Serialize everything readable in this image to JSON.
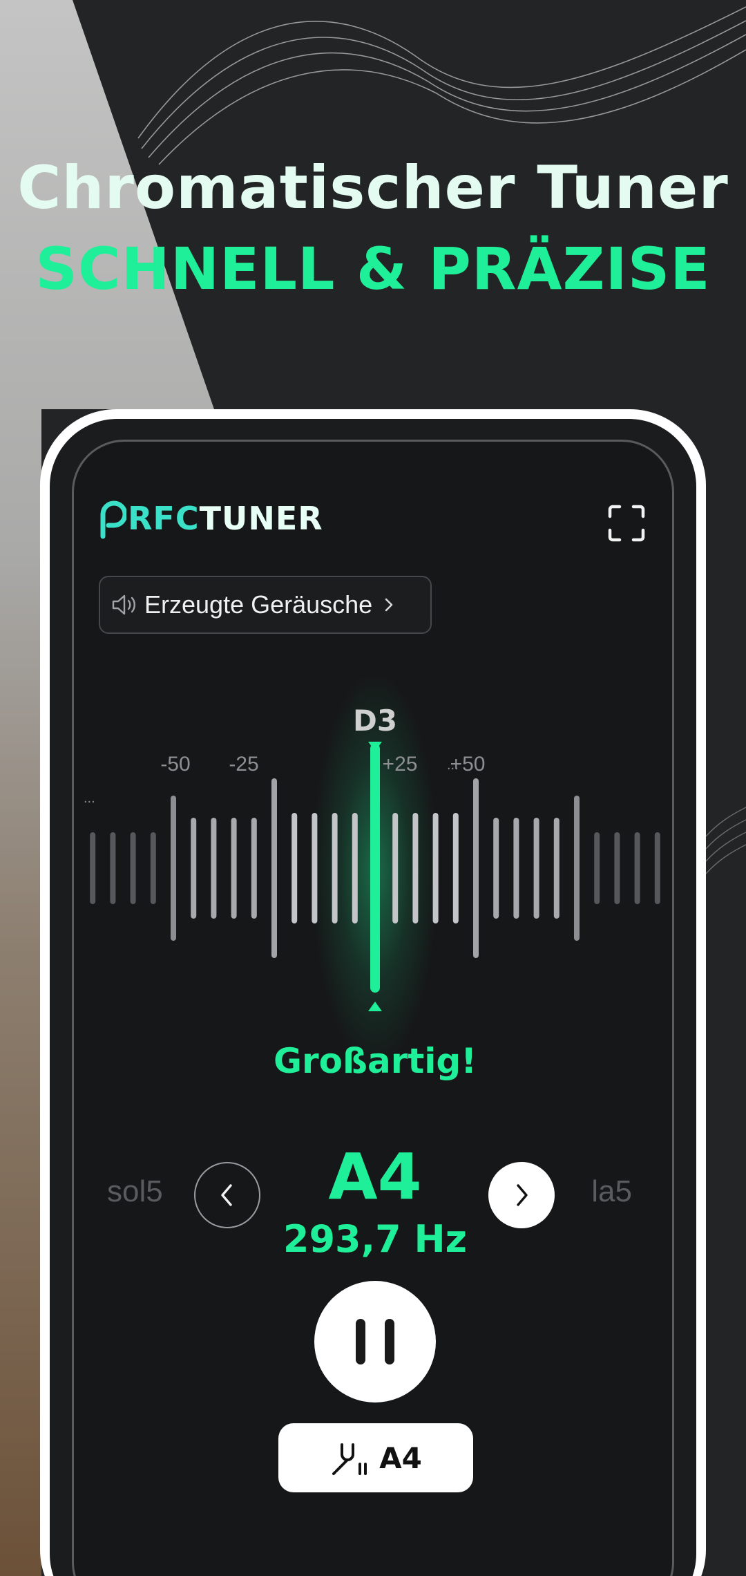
{
  "headline": {
    "line1": "Chromatischer Tuner",
    "line2": "SCHNELL & PRÄZISE"
  },
  "colors": {
    "accent": "#1fef98",
    "background": "#232425",
    "screen": "#161718"
  },
  "app": {
    "logo_part1": "RFC",
    "logo_part2": "TUNER",
    "fullscreen_icon": "fullscreen-icon"
  },
  "noise_button": {
    "icon": "speaker-icon",
    "label": "Erzeugte Geräusche"
  },
  "meter": {
    "detected_note": "D3",
    "tick_labels": [
      "-50",
      "-25",
      "+25",
      "+50"
    ],
    "overflow_marker": "...",
    "deviation_cents": 0
  },
  "status": "Großartig!",
  "note_selector": {
    "previous": "sol5",
    "current": "A4",
    "next": "la5",
    "frequency": "293,7 Hz"
  },
  "controls": {
    "pause_icon": "pause-icon",
    "reference_icon": "tuning-fork-icon",
    "reference_label": "A4"
  }
}
